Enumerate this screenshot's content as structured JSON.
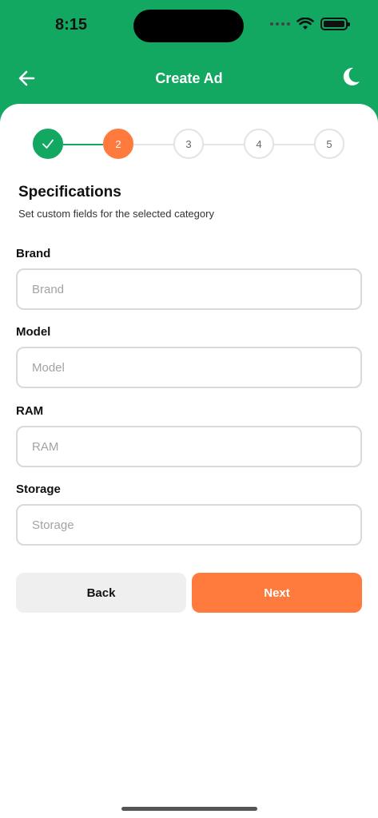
{
  "status_bar": {
    "time": "8:15"
  },
  "header": {
    "title": "Create Ad",
    "back_icon": "arrow-left-icon",
    "theme_icon": "moon-icon"
  },
  "stepper": {
    "steps": [
      {
        "label": "",
        "state": "complete"
      },
      {
        "label": "2",
        "state": "active"
      },
      {
        "label": "3",
        "state": "pending"
      },
      {
        "label": "4",
        "state": "pending"
      },
      {
        "label": "5",
        "state": "pending"
      }
    ]
  },
  "section": {
    "title": "Specifications",
    "subtitle": "Set custom fields for the selected category"
  },
  "fields": [
    {
      "label": "Brand",
      "placeholder": "Brand",
      "value": ""
    },
    {
      "label": "Model",
      "placeholder": "Model",
      "value": ""
    },
    {
      "label": "RAM",
      "placeholder": "RAM",
      "value": ""
    },
    {
      "label": "Storage",
      "placeholder": "Storage",
      "value": ""
    }
  ],
  "actions": {
    "back_label": "Back",
    "next_label": "Next"
  },
  "colors": {
    "brand_green": "#12a862",
    "accent_orange": "#ff7a3d"
  }
}
